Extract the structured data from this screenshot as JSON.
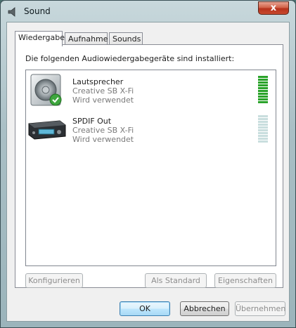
{
  "window": {
    "title": "Sound",
    "close_label": "x"
  },
  "tabs": [
    {
      "label": "Wiedergabe"
    },
    {
      "label": "Aufnahme"
    },
    {
      "label": "Sounds"
    }
  ],
  "panel": {
    "description": "Die folgenden Audiowiedergabegeräte sind installiert:"
  },
  "devices": [
    {
      "name": "Lautsprecher",
      "driver": "Creative SB X-Fi",
      "status": "Wird verwendet",
      "default": true,
      "level": 1.0
    },
    {
      "name": "SPDIF Out",
      "driver": "Creative SB X-Fi",
      "status": "Wird verwendet",
      "default": false,
      "level": 0.0
    }
  ],
  "panel_buttons": {
    "configure": "Konfigurieren",
    "set_default": "Als Standard",
    "properties": "Eigenschaften"
  },
  "dialog_buttons": {
    "ok": "OK",
    "cancel": "Abbrechen",
    "apply": "Übernehmen"
  },
  "colors": {
    "meter_active": "#2aa32a",
    "meter_inactive": "#c9dede",
    "default_check": "#3ea63e"
  }
}
